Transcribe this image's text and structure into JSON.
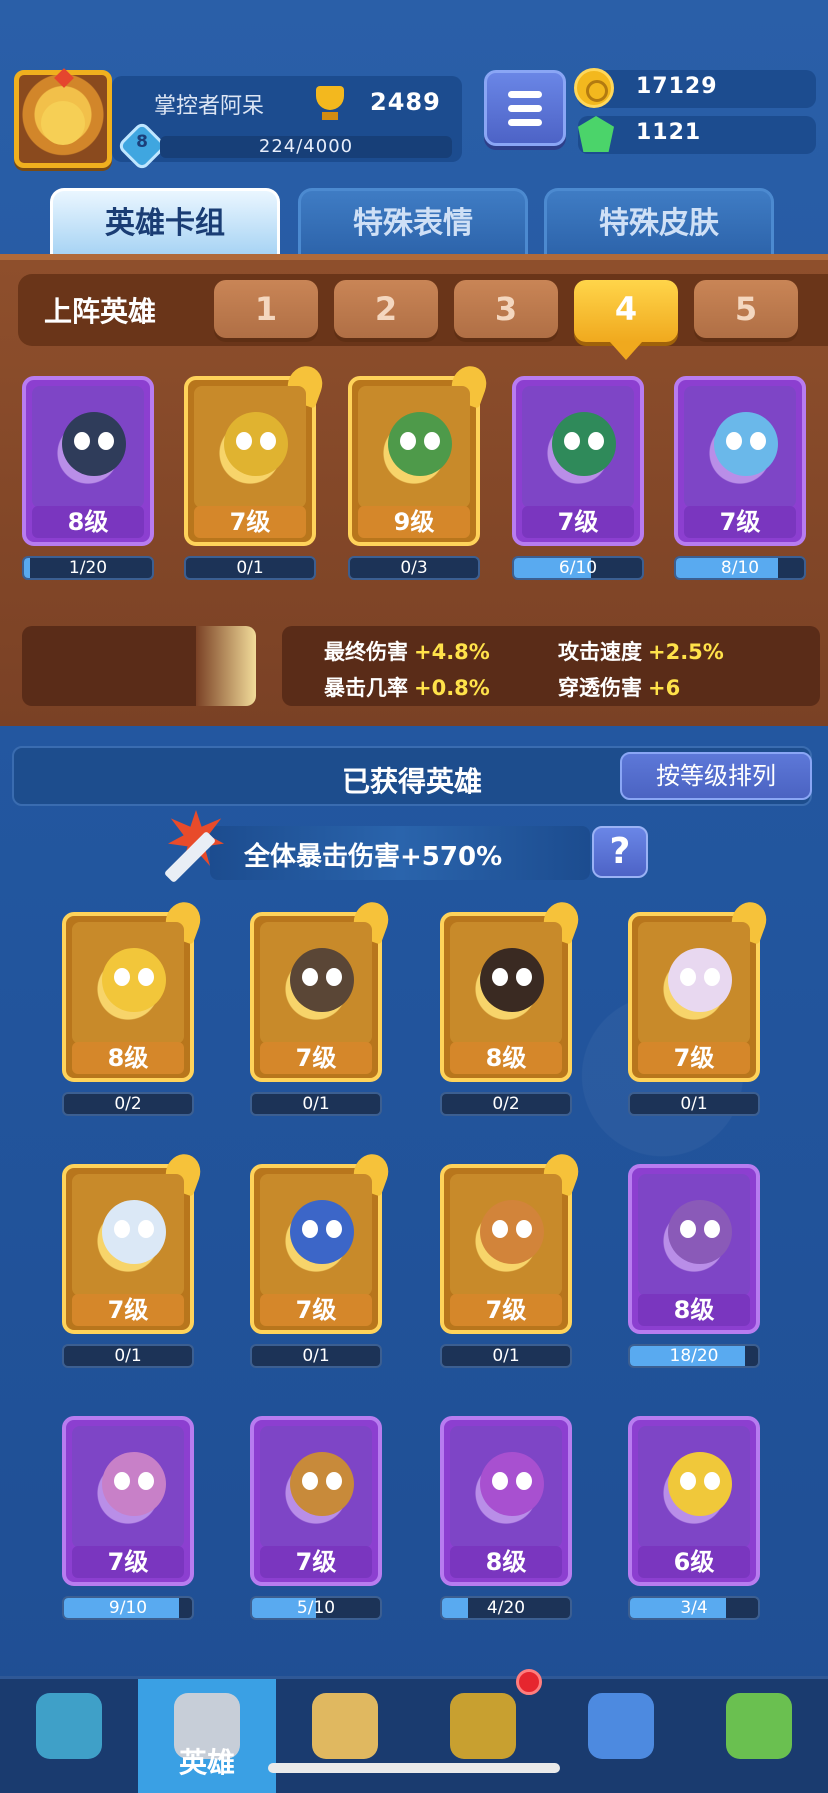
{
  "player": {
    "name": "掌控者阿呆",
    "trophies": "2489",
    "level": "8",
    "xp_text": "224/4000",
    "xp_fraction": 0.056
  },
  "resources": {
    "gold": "17129",
    "gems": "1121"
  },
  "tabs": [
    {
      "label": "英雄卡组",
      "active": true
    },
    {
      "label": "特殊表情",
      "active": false
    },
    {
      "label": "特殊皮肤",
      "active": false
    }
  ],
  "deck": {
    "title": "上阵英雄",
    "slots": [
      "1",
      "2",
      "3",
      "4",
      "5"
    ],
    "active_slot": "4",
    "heroes": [
      {
        "level": "8级",
        "progress": "1/20",
        "fraction": 0.05,
        "rarity": "purple",
        "color": "#2f3c5a"
      },
      {
        "level": "7级",
        "progress": "0/1",
        "fraction": 0,
        "rarity": "gold",
        "color": "#e0b330"
      },
      {
        "level": "9级",
        "progress": "0/3",
        "fraction": 0,
        "rarity": "gold",
        "color": "#4e9a4a"
      },
      {
        "level": "7级",
        "progress": "6/10",
        "fraction": 0.6,
        "rarity": "purple",
        "color": "#2f8a5a"
      },
      {
        "level": "7级",
        "progress": "8/10",
        "fraction": 0.8,
        "rarity": "purple",
        "color": "#6ab8ea"
      }
    ],
    "stats": [
      {
        "label": "最终伤害",
        "value": "+4.8%"
      },
      {
        "label": "攻击速度",
        "value": "+2.5%"
      },
      {
        "label": "暴击几率",
        "value": "+0.8%"
      },
      {
        "label": "穿透伤害",
        "value": "+6"
      }
    ]
  },
  "obtained": {
    "title": "已获得英雄",
    "sort_label": "按等级排列",
    "crit_label": "全体暴击伤害",
    "crit_value": "+570%",
    "help_label": "?",
    "heroes": [
      {
        "level": "8级",
        "progress": "0/2",
        "fraction": 0,
        "rarity": "gold",
        "color": "#f2c63a"
      },
      {
        "level": "7级",
        "progress": "0/1",
        "fraction": 0,
        "rarity": "gold",
        "color": "#5a4636"
      },
      {
        "level": "8级",
        "progress": "0/2",
        "fraction": 0,
        "rarity": "gold",
        "color": "#3a2a22"
      },
      {
        "level": "7级",
        "progress": "0/1",
        "fraction": 0,
        "rarity": "gold",
        "color": "#e8d8f0"
      },
      {
        "level": "7级",
        "progress": "0/1",
        "fraction": 0,
        "rarity": "gold",
        "color": "#dbe8f6"
      },
      {
        "level": "7级",
        "progress": "0/1",
        "fraction": 0,
        "rarity": "gold",
        "color": "#3c66c8"
      },
      {
        "level": "7级",
        "progress": "0/1",
        "fraction": 0,
        "rarity": "gold",
        "color": "#d2843a"
      },
      {
        "level": "8级",
        "progress": "18/20",
        "fraction": 0.9,
        "rarity": "purple",
        "color": "#8a5ab8"
      },
      {
        "level": "7级",
        "progress": "9/10",
        "fraction": 0.9,
        "rarity": "purple",
        "color": "#c880c8"
      },
      {
        "level": "7级",
        "progress": "5/10",
        "fraction": 0.5,
        "rarity": "purple",
        "color": "#c88a3a"
      },
      {
        "level": "8级",
        "progress": "4/20",
        "fraction": 0.2,
        "rarity": "purple",
        "color": "#a850d0"
      },
      {
        "level": "6级",
        "progress": "3/4",
        "fraction": 0.75,
        "rarity": "purple",
        "color": "#f0c83a"
      }
    ]
  },
  "nav": [
    {
      "icon": "treasure-chest-icon",
      "label": "",
      "active": false
    },
    {
      "icon": "knight-helmet-icon",
      "label": "英雄",
      "active": true
    },
    {
      "icon": "crossed-swords-icon",
      "label": "",
      "active": false
    },
    {
      "icon": "crown-shield-icon",
      "label": "",
      "active": false,
      "badge": true
    },
    {
      "icon": "friends-banner-icon",
      "label": "",
      "active": false
    },
    {
      "icon": "sprout-island-icon",
      "label": "",
      "active": false
    }
  ]
}
